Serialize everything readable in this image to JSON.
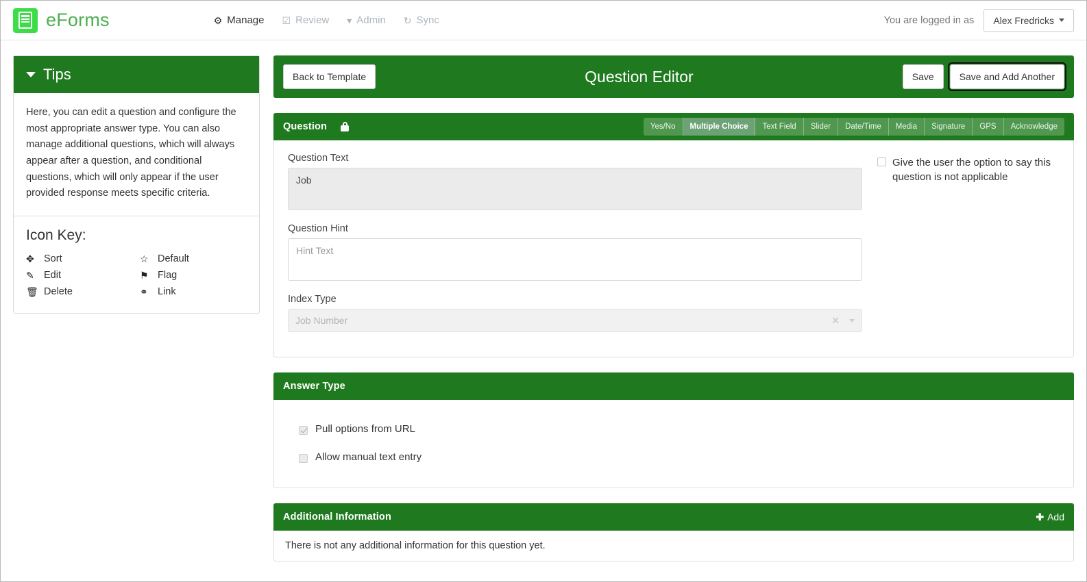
{
  "navbar": {
    "brand": "eForms",
    "logo_icon": "form-document-icon",
    "logo_color": "#3ddc49",
    "items": [
      {
        "label": "Manage",
        "icon": "gear-icon",
        "glyph": "⚙",
        "state": "active"
      },
      {
        "label": "Review",
        "icon": "checkbox-checked-icon",
        "glyph": "☑",
        "state": "muted"
      },
      {
        "label": "Admin",
        "icon": "caret-down-icon",
        "glyph": "▾",
        "state": "muted"
      },
      {
        "label": "Sync",
        "icon": "refresh-icon",
        "glyph": "↻",
        "state": "muted"
      }
    ],
    "logged_in_text": "You are logged in as",
    "user_name": "Alex Fredricks"
  },
  "tips": {
    "title": "Tips",
    "body": "Here, you can edit a question and configure the most appropriate answer type. You can also manage additional questions, which will always appear after a question, and conditional questions, which will only appear if the user provided response meets specific criteria.",
    "icon_key_title": "Icon Key:",
    "icon_key": [
      {
        "icon": "sort-arrows-icon",
        "glyph": "✥",
        "label": "Sort"
      },
      {
        "icon": "star-outline-icon",
        "glyph": "☆",
        "label": "Default"
      },
      {
        "icon": "edit-pencil-icon",
        "glyph": "✎",
        "label": "Edit"
      },
      {
        "icon": "flag-icon",
        "glyph": "⚑",
        "label": "Flag"
      },
      {
        "icon": "trash-icon",
        "glyph": "Ὕ1",
        "label": "Delete"
      },
      {
        "icon": "link-chain-icon",
        "glyph": "⚭",
        "label": "Link"
      }
    ]
  },
  "editor_bar": {
    "back_label": "Back to Template",
    "title": "Question Editor",
    "save_label": "Save",
    "save_add_label": "Save and Add Another",
    "focused_button": "Save and Add Another"
  },
  "question_panel": {
    "title": "Question",
    "lock_icon": "lock-closed-icon",
    "answer_types": [
      {
        "label": "Yes/No",
        "selected": false
      },
      {
        "label": "Multiple Choice",
        "selected": true
      },
      {
        "label": "Text Field",
        "selected": false
      },
      {
        "label": "Slider",
        "selected": false
      },
      {
        "label": "Date/Time",
        "selected": false
      },
      {
        "label": "Media",
        "selected": false
      },
      {
        "label": "Signature",
        "selected": false
      },
      {
        "label": "GPS",
        "selected": false
      },
      {
        "label": "Acknowledge",
        "selected": false
      }
    ],
    "question_text_label": "Question Text",
    "question_text_value": "Job",
    "question_hint_label": "Question Hint",
    "question_hint_placeholder": "Hint Text",
    "question_hint_value": "",
    "index_type_label": "Index Type",
    "index_type_value": "Job Number",
    "index_clear_icon": "clear-x-icon",
    "index_caret_icon": "caret-down-icon",
    "na_option_label": "Give the user the option to say this question is not applicable",
    "na_option_checked": false
  },
  "answer_type_panel": {
    "title": "Answer Type",
    "options": [
      {
        "label": "Pull options from URL",
        "checked": true,
        "disabled": true
      },
      {
        "label": "Allow manual text entry",
        "checked": false,
        "disabled": true
      }
    ]
  },
  "additional_info_panel": {
    "title": "Additional Information",
    "add_label": "Add",
    "add_icon": "plus-icon",
    "empty_text": "There is not any additional information for this question yet."
  },
  "theme": {
    "green_dark": "#1f7a1f",
    "green_brand": "#4caf50",
    "tab_selected": "#6ca276"
  }
}
